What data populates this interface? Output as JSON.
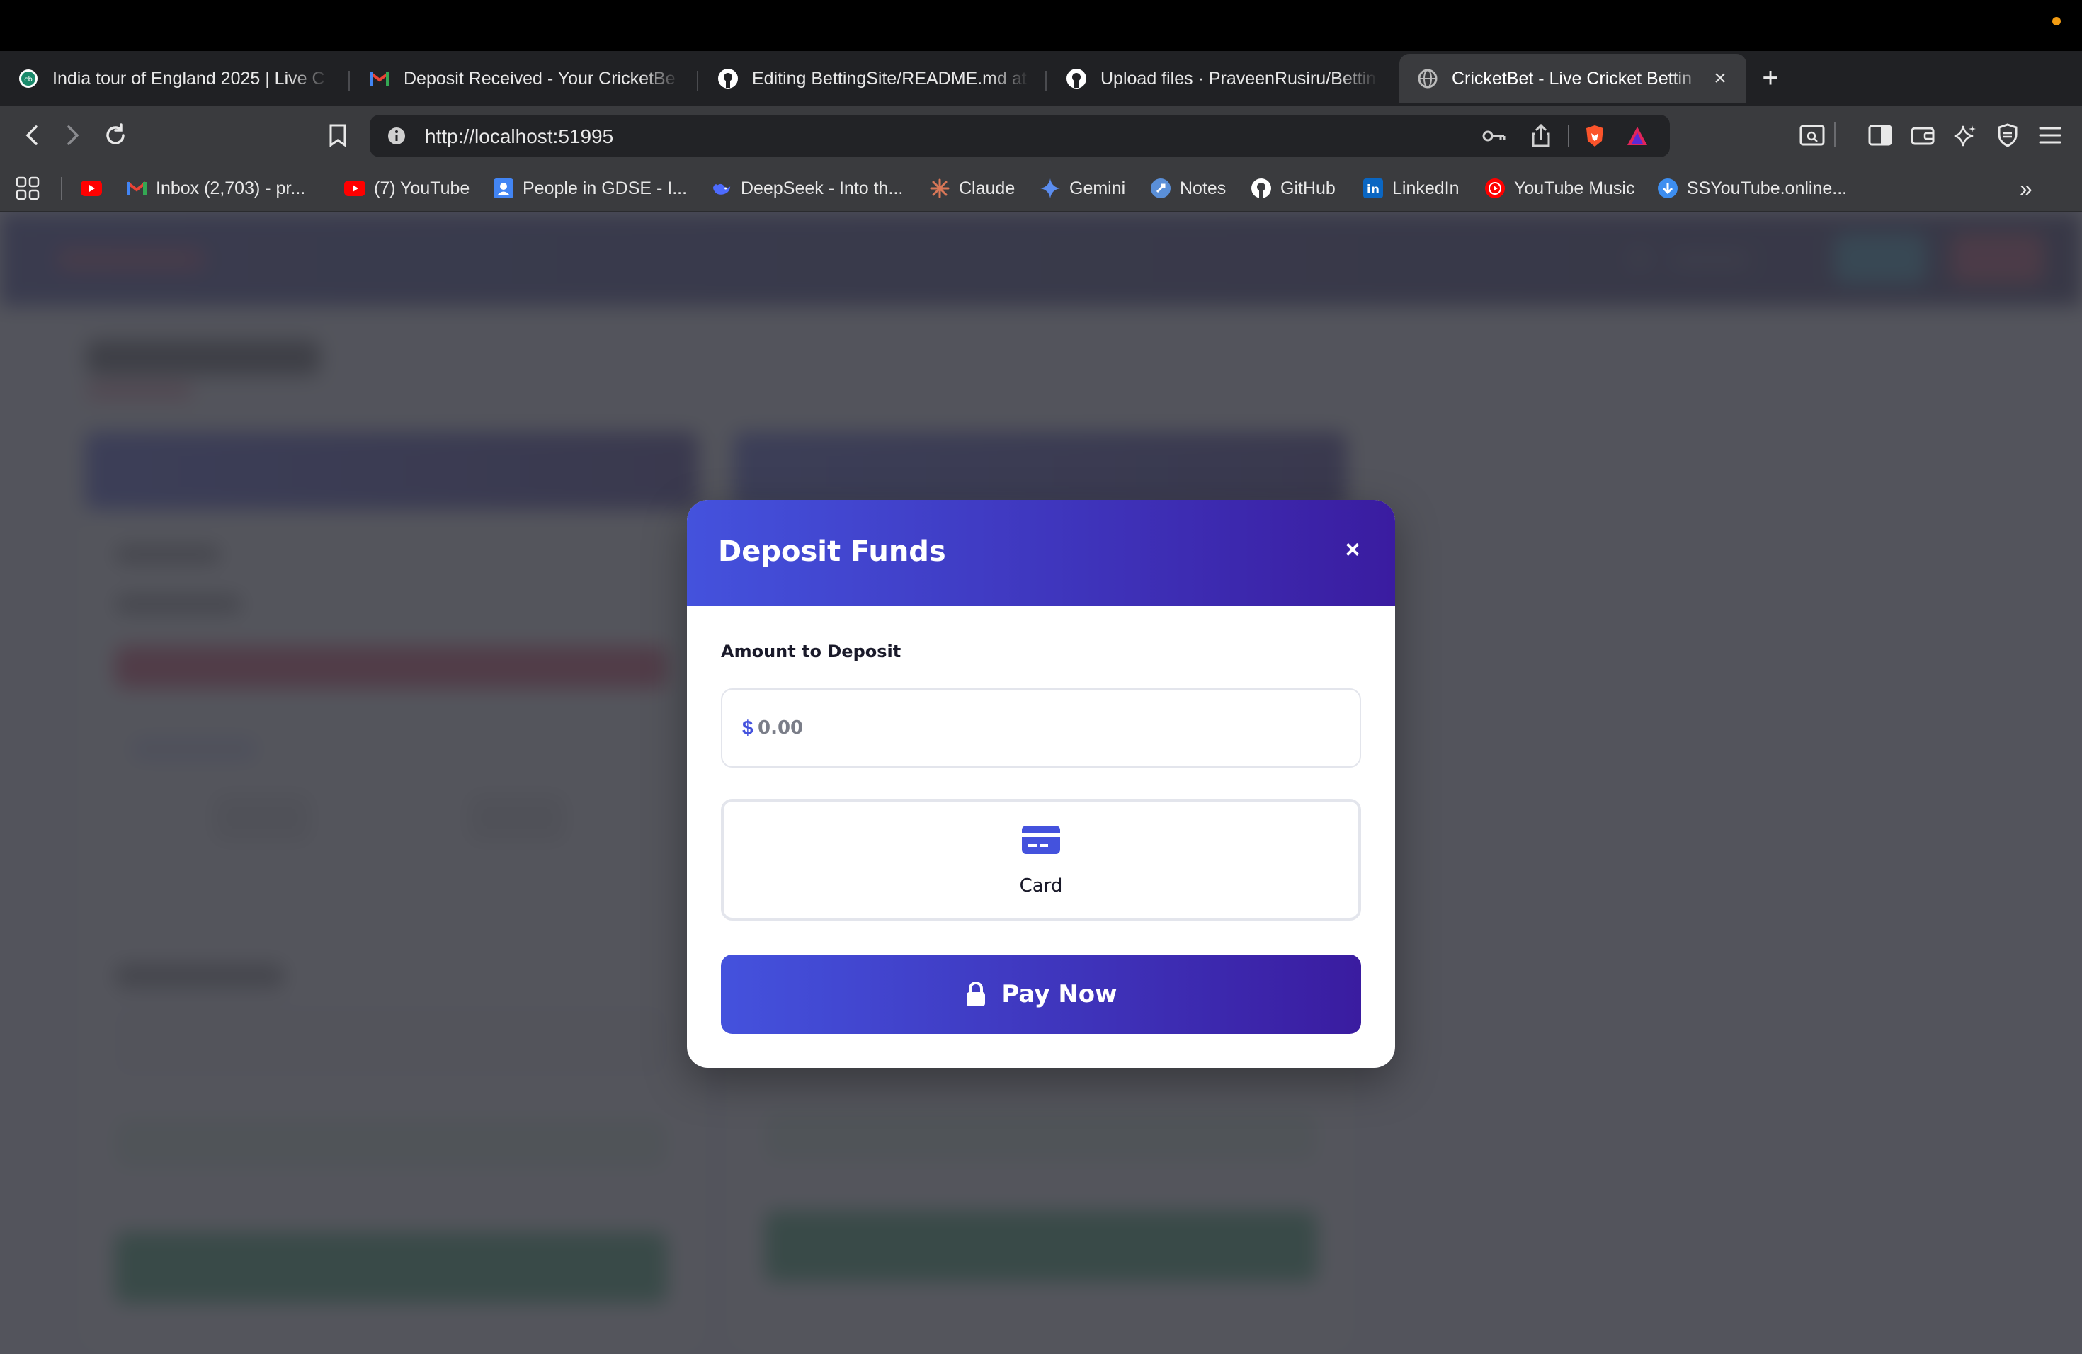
{
  "browser": {
    "tabs": [
      {
        "title": "India tour of England 2025 | Live C",
        "active": false
      },
      {
        "title": "Deposit Received - Your CricketBe",
        "active": false
      },
      {
        "title": "Editing BettingSite/README.md at",
        "active": false
      },
      {
        "title": "Upload files · PraveenRusiru/Bettin",
        "active": false
      },
      {
        "title": "CricketBet - Live Cricket Bettin",
        "active": true
      }
    ],
    "address": "http://localhost:51995",
    "bookmarks": [
      {
        "label": ""
      },
      {
        "label": "Inbox (2,703) - pr..."
      },
      {
        "label": "(7) YouTube"
      },
      {
        "label": "People in GDSE - I..."
      },
      {
        "label": "DeepSeek - Into th..."
      },
      {
        "label": "Claude"
      },
      {
        "label": "Gemini"
      },
      {
        "label": "Notes"
      },
      {
        "label": "GitHub"
      },
      {
        "label": "LinkedIn"
      },
      {
        "label": "YouTube Music"
      },
      {
        "label": "SSYouTube.online..."
      }
    ],
    "bookmarks_overflow": "»"
  },
  "modal": {
    "title": "Deposit Funds",
    "close": "×",
    "amount_label": "Amount to Deposit",
    "currency": "$",
    "amount_placeholder": "0.00",
    "amount_value": "",
    "payment_method": "Card",
    "pay_button": "Pay Now"
  },
  "colors": {
    "accent_start": "#4452dd",
    "accent_end": "#3a1ca0",
    "page_overlay": "#3c3e46"
  },
  "icons": {
    "tab_favicons": [
      "cricbuzz-icon",
      "gmail-icon",
      "github-icon",
      "github-icon",
      "globe-icon"
    ],
    "payment": "credit-card-icon",
    "pay": "lock-icon"
  }
}
